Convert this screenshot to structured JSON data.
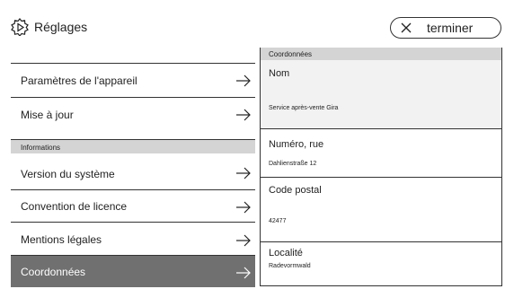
{
  "header": {
    "title": "Réglages",
    "settings_icon": "gear-play-icon",
    "done_icon": "close-icon",
    "done_label": "terminer"
  },
  "left": {
    "items_top": [
      {
        "label": "Paramètres de l'appareil",
        "icon": "arrow-right-icon"
      },
      {
        "label": "Mise à jour",
        "icon": "arrow-right-icon"
      }
    ],
    "section_label": "Informations",
    "items_info": [
      {
        "label": "Version du système",
        "icon": "arrow-right-icon"
      },
      {
        "label": "Convention de licence",
        "icon": "arrow-right-icon"
      },
      {
        "label": "Mentions légales",
        "icon": "arrow-right-icon"
      },
      {
        "label": "Coordonnées",
        "icon": "arrow-right-icon",
        "selected": true
      }
    ]
  },
  "right": {
    "section_label": "Coordonnées",
    "fields": [
      {
        "label": "Nom",
        "value": "Service après-vente Gira"
      },
      {
        "label": "Numéro, rue",
        "value": "Dahlienstraße 12"
      },
      {
        "label": "Code postal",
        "value": "42477"
      },
      {
        "label": "Localité",
        "value": "Radevormwald"
      }
    ]
  },
  "colors": {
    "selected_bg": "#707070",
    "section_bg": "#d4d4d4",
    "border": "#333333"
  }
}
